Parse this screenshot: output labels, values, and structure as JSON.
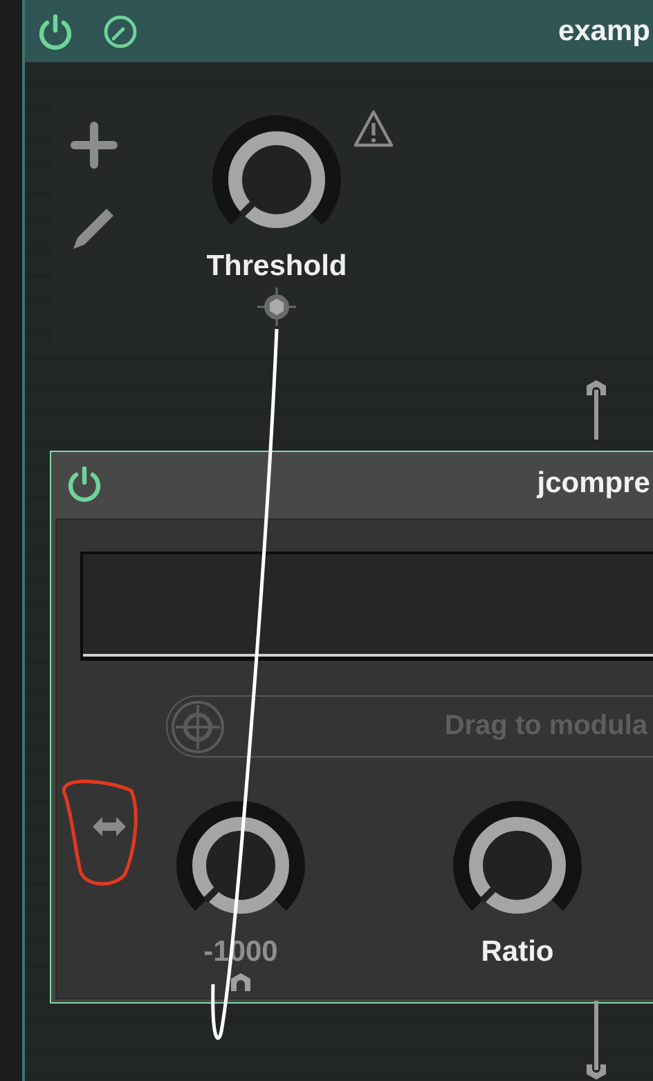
{
  "header": {
    "power_on": true,
    "title": "examp"
  },
  "macro_panel": {
    "knobs": [
      {
        "label": "Threshold",
        "level": 0
      }
    ]
  },
  "device": {
    "power_on": true,
    "title": "jcompre",
    "modulation_hint": "Drag to modula",
    "knobs": [
      {
        "label": "-1000",
        "level": 0,
        "kind": "value"
      },
      {
        "label": "Ratio",
        "level": 0,
        "kind": "name"
      }
    ]
  }
}
